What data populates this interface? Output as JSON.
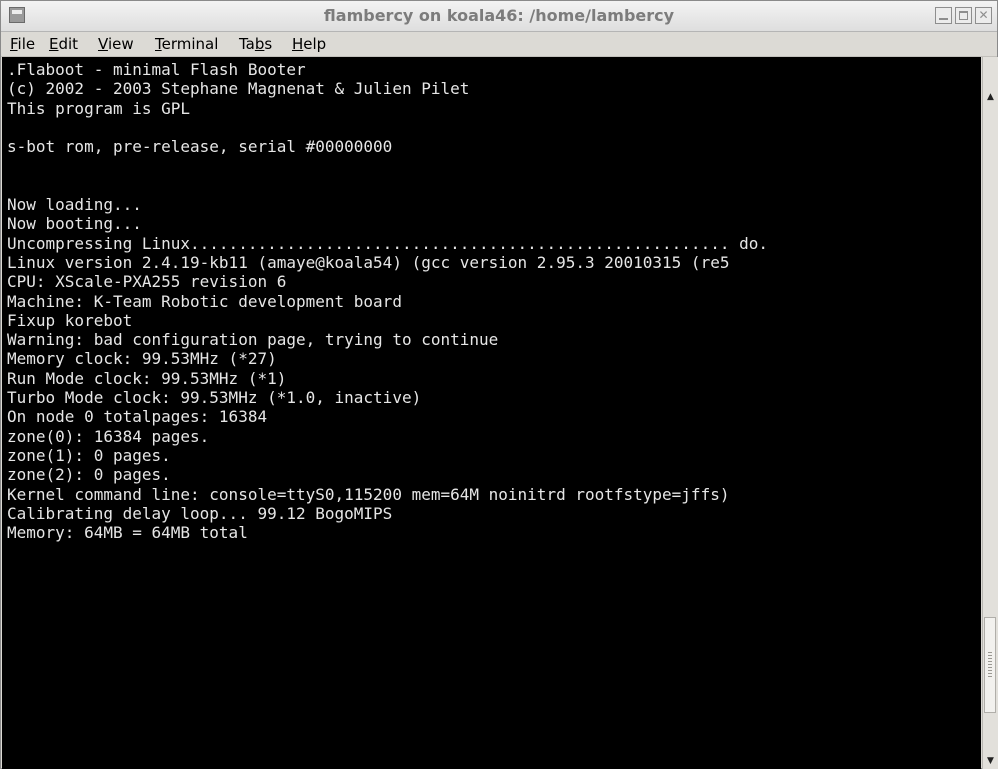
{
  "window": {
    "title": "flambercy on koala46: /home/lambercy"
  },
  "menu": [
    {
      "label": "File",
      "name": "menu-file"
    },
    {
      "label": "Edit",
      "name": "menu-edit"
    },
    {
      "label": "View",
      "name": "menu-view"
    },
    {
      "label": "Terminal",
      "name": "menu-terminal"
    },
    {
      "label": "Tabs",
      "name": "menu-tabs"
    },
    {
      "label": "Help",
      "name": "menu-help"
    }
  ],
  "terminal": {
    "lines": [
      ".Flaboot - minimal Flash Booter",
      "(c) 2002 - 2003 Stephane Magnenat & Julien Pilet",
      "This program is GPL",
      "",
      "s-bot rom, pre-release, serial #00000000",
      "",
      "",
      "Now loading...",
      "Now booting...",
      "Uncompressing Linux........................................................ do.",
      "Linux version 2.4.19-kb11 (amaye@koala54) (gcc version 2.95.3 20010315 (re5",
      "CPU: XScale-PXA255 revision 6",
      "Machine: K-Team Robotic development board",
      "Fixup korebot",
      "Warning: bad configuration page, trying to continue",
      "Memory clock: 99.53MHz (*27)",
      "Run Mode clock: 99.53MHz (*1)",
      "Turbo Mode clock: 99.53MHz (*1.0, inactive)",
      "On node 0 totalpages: 16384",
      "zone(0): 16384 pages.",
      "zone(1): 0 pages.",
      "zone(2): 0 pages.",
      "Kernel command line: console=ttyS0,115200 mem=64M noinitrd rootfstype=jffs)",
      "Calibrating delay loop... 99.12 BogoMIPS",
      "Memory: 64MB = 64MB total"
    ]
  },
  "icons": {
    "app": "terminal-app-icon",
    "minimize": "minimize-icon",
    "maximize": "maximize-icon",
    "close": "close-icon",
    "scroll_up": "scroll-up-arrow-icon",
    "scroll_down": "scroll-down-arrow-icon"
  }
}
